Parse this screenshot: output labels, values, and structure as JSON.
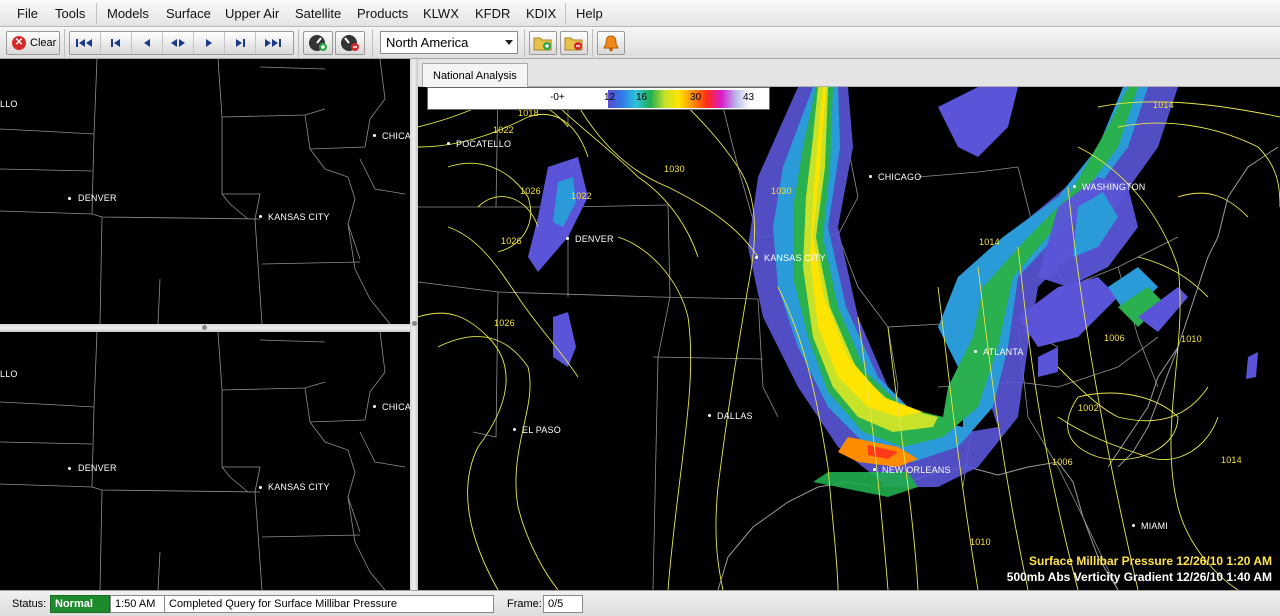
{
  "menubar": {
    "items": [
      "File",
      "Tools",
      "Models",
      "Surface",
      "Upper Air",
      "Satellite",
      "Products",
      "KLWX",
      "KFDR",
      "KDIX",
      "Help"
    ]
  },
  "toolbar": {
    "clear_label": "Clear",
    "region_value": "North America",
    "icons": [
      "first-frame-icon",
      "step-back-icon",
      "play-backward-icon",
      "rock-icon",
      "play-forward-icon",
      "step-forward-icon",
      "last-frame-icon",
      "speed-up-icon",
      "speed-down-icon",
      "add-panel-icon",
      "remove-panel-icon",
      "alert-bell-icon"
    ]
  },
  "left_panels": {
    "top": {
      "cities": [
        "LLO",
        "DENVER",
        "KANSAS CITY",
        "CHICA"
      ]
    },
    "bottom": {
      "cities": [
        "LLO",
        "DENVER",
        "KANSAS CITY",
        "CHICA"
      ]
    }
  },
  "main_panel": {
    "tab_label": "National Analysis",
    "colorbar": {
      "labels": [
        "-0+",
        "12",
        "16",
        "30",
        "43"
      ]
    },
    "cities": [
      "POCATELLO",
      "DENVER",
      "KANSAS CITY",
      "CHICAGO",
      "WASHINGTON",
      "ATLANTA",
      "DALLAS",
      "EL PASO",
      "NEW ORLEANS",
      "MIAMI"
    ],
    "contour_labels": [
      "1018",
      "1022",
      "1026",
      "1022",
      "1026",
      "1030",
      "1030",
      "1026",
      "1014",
      "1014",
      "1006",
      "1010",
      "1002",
      "1006",
      "1014",
      "1010"
    ],
    "legend": {
      "line1": "Surface Millibar Pressure 12/26/10 1:20 AM",
      "line1_color": "#ffe24a",
      "line2": "500mb Abs Verticity Gradient 12/26/10 1:40 AM",
      "line2_color": "#ffffff"
    }
  },
  "statusbar": {
    "status_label": "Status:",
    "status_value": "Normal",
    "status_color": "#1e8a2e",
    "time": "1:50 AM",
    "message": "Completed Query for Surface Millibar Pressure",
    "frame_label": "Frame:",
    "frame_value": "0/5"
  }
}
